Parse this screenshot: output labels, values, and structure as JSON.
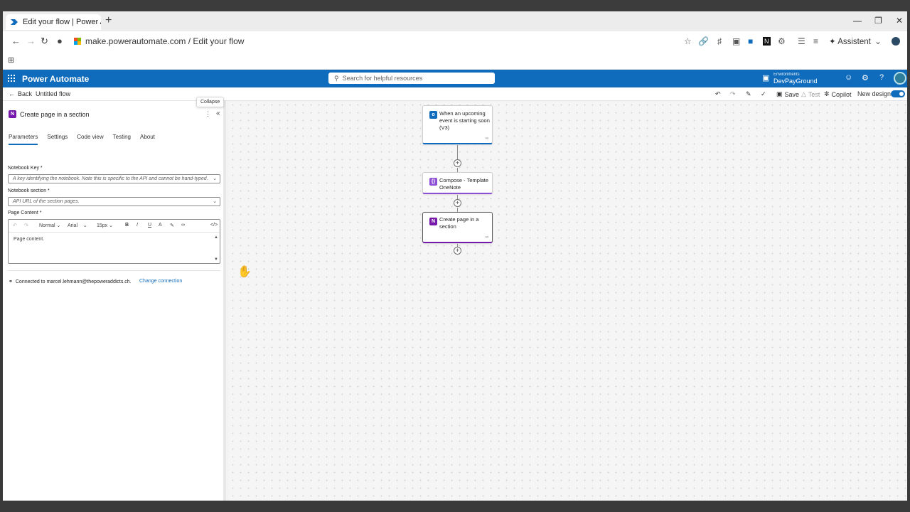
{
  "browser": {
    "tab_title": "Edit your flow | Power Automate",
    "new_tab": "+",
    "url": "make.powerautomate.com / Edit your flow",
    "assistant_label": "Assistent"
  },
  "header": {
    "app_name": "Power Automate",
    "search_placeholder": "Search for helpful resources",
    "env_label": "Environments",
    "env_name": "DevPayGround"
  },
  "command_bar": {
    "back_label": "Back",
    "flow_name": "Untitled flow",
    "save_label": "Save",
    "test_label": "Test",
    "copilot_label": "Copilot",
    "new_designer_label": "New designer"
  },
  "panel": {
    "tooltip": "Collapse",
    "title": "Create page in a section",
    "tabs": [
      "Parameters",
      "Settings",
      "Code view",
      "Testing",
      "About"
    ],
    "fields": [
      {
        "label": "Notebook Key *",
        "placeholder": "A key identifying the notebook. Note this is specific to the API and cannot be hand-typed."
      },
      {
        "label": "Notebook section *",
        "placeholder": "API URL of the section pages."
      }
    ],
    "content_label": "Page Content *",
    "editor": {
      "style": "Normal",
      "font": "Arial",
      "size": "15px",
      "text": "Page content."
    },
    "connected_text": "Connected to marcel.lehmann@thepoweraddicts.ch.",
    "change_connection": "Change connection"
  },
  "flow": {
    "steps": [
      {
        "label": "When an upcoming event is starting soon (V3)",
        "icon": "outlook-calendar-icon",
        "color": "#0f6cbd"
      },
      {
        "label": "Compose - Template OneNote",
        "icon": "compose-icon",
        "color": "#8c4fd6"
      },
      {
        "label": "Create page in a section",
        "icon": "onenote-icon",
        "color": "#7719aa"
      }
    ]
  },
  "colors": {
    "brand": "#0f6cbd",
    "onenote": "#7719aa"
  }
}
